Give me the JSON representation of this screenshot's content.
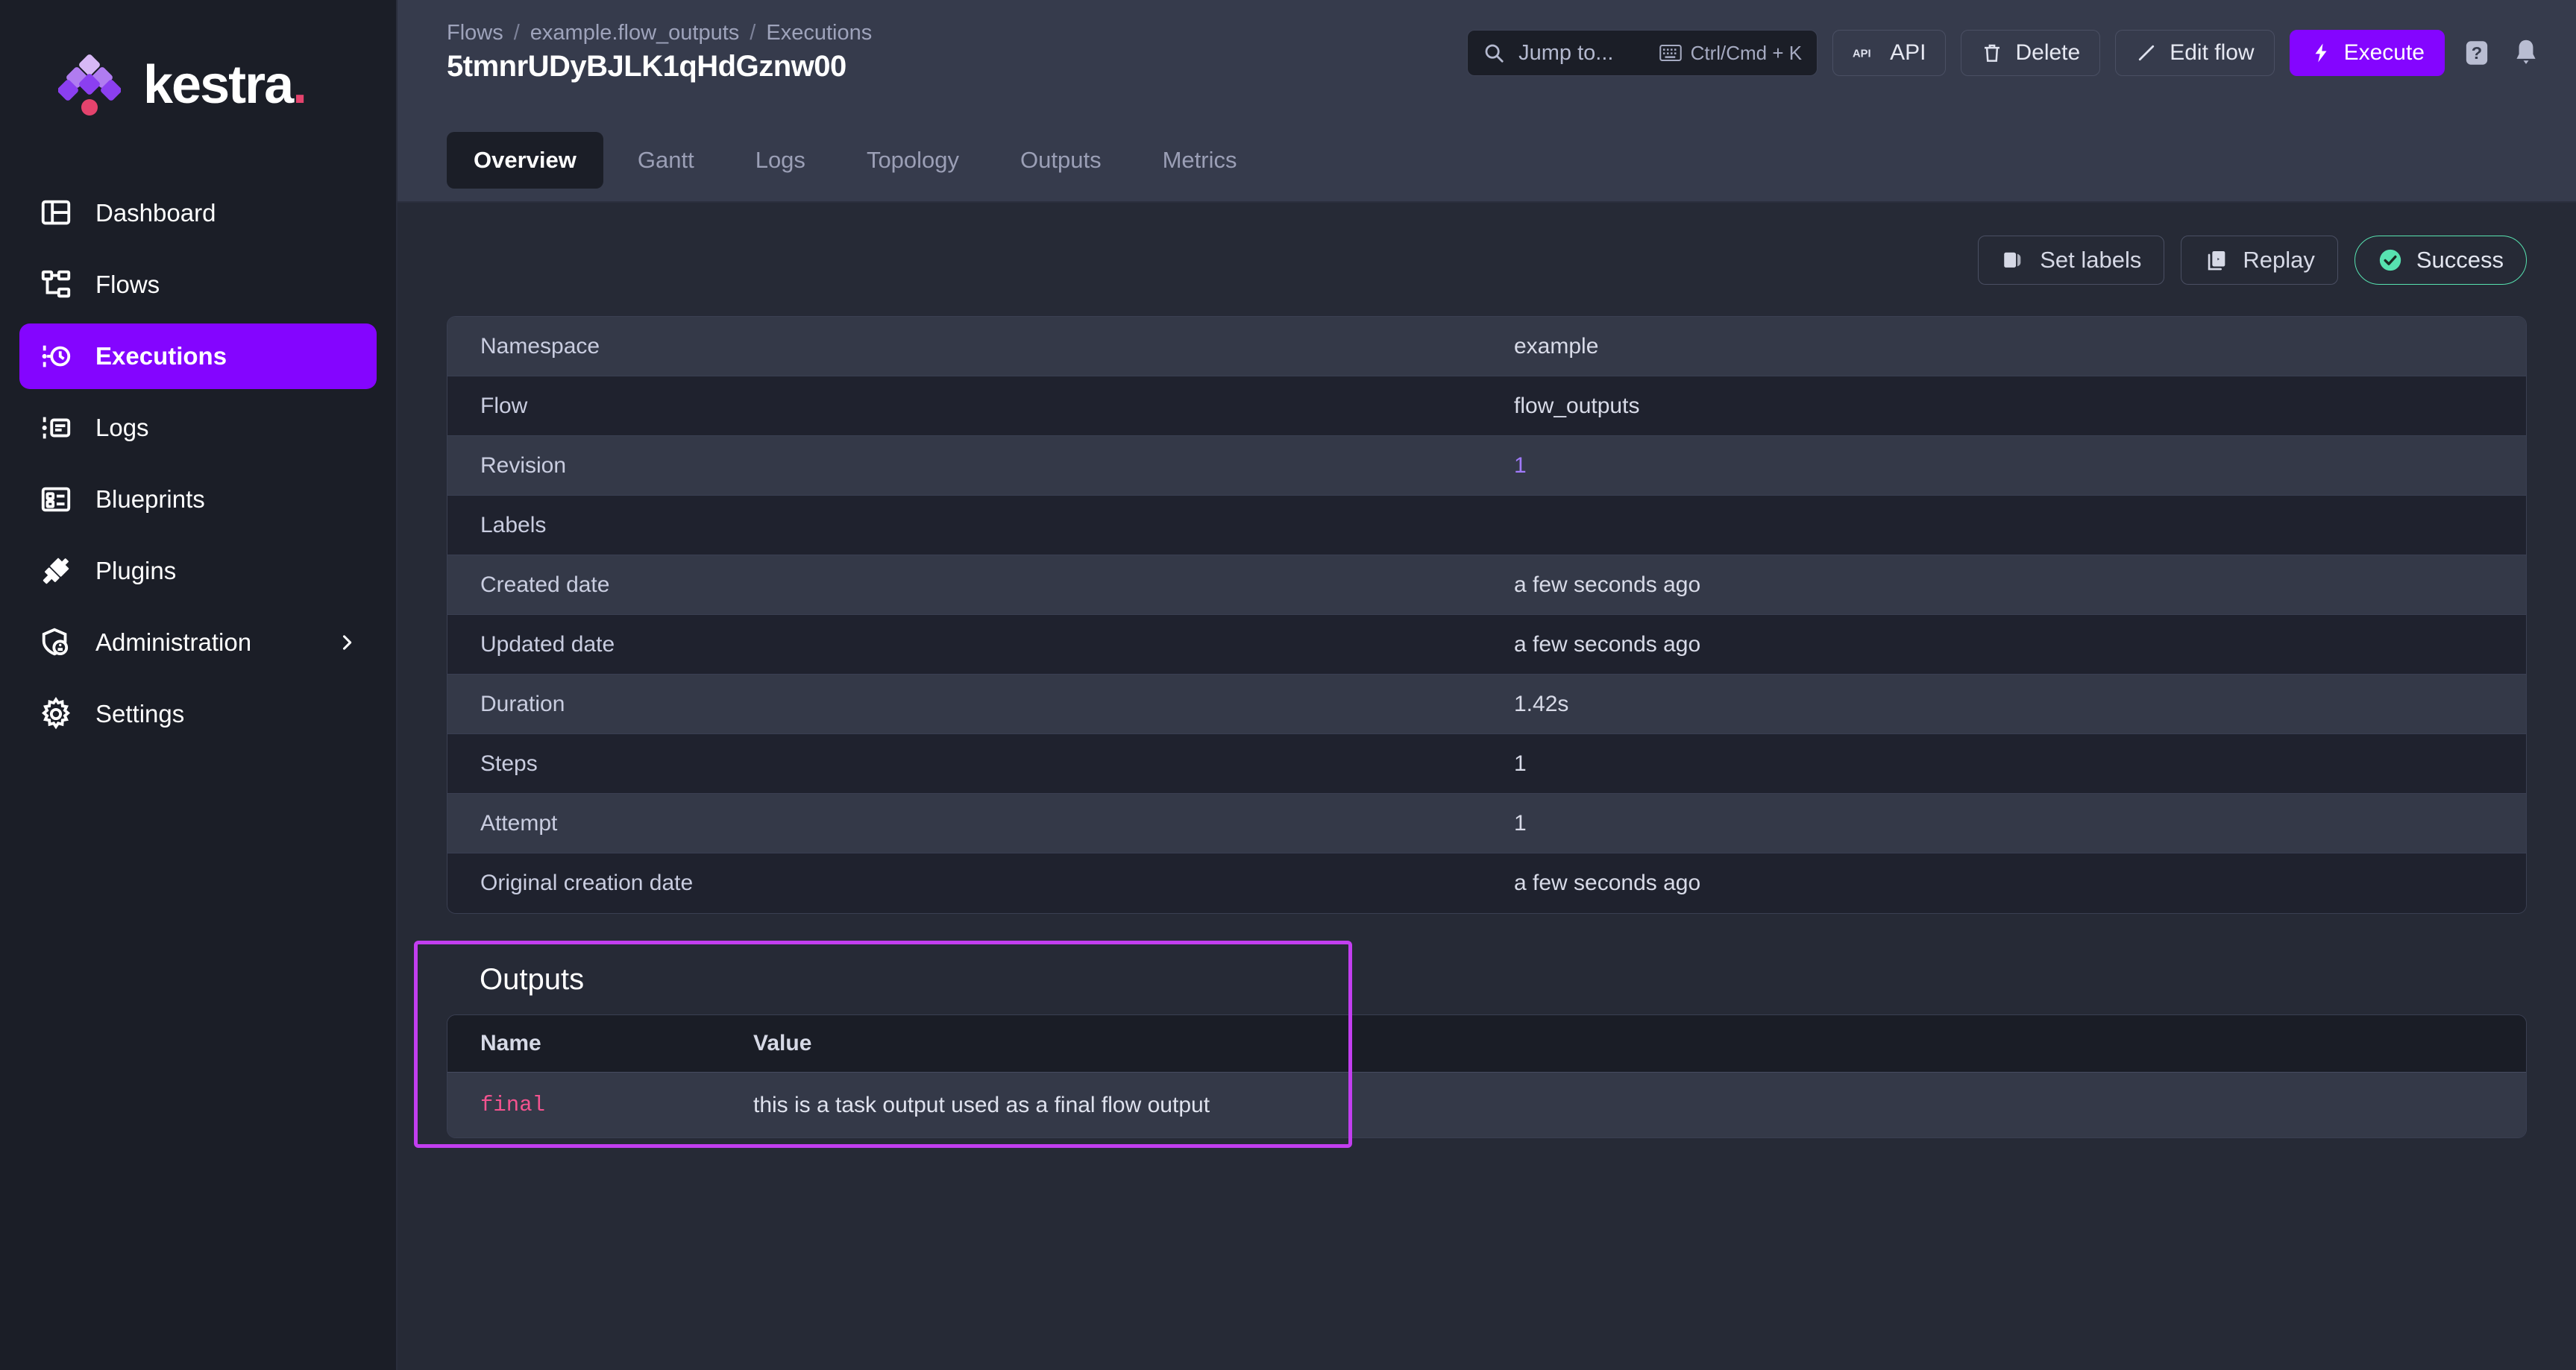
{
  "brand": {
    "name": "kestra",
    "dot": ".",
    "logo_colors": [
      "#d7b8f5",
      "#b07cf0",
      "#9b5cf0",
      "#8b3ff0",
      "#e4436d"
    ]
  },
  "sidebar": {
    "items": [
      {
        "label": "Dashboard",
        "icon": "dashboard-icon",
        "active": false
      },
      {
        "label": "Flows",
        "icon": "flows-icon",
        "active": false
      },
      {
        "label": "Executions",
        "icon": "executions-icon",
        "active": true
      },
      {
        "label": "Logs",
        "icon": "logs-icon",
        "active": false
      },
      {
        "label": "Blueprints",
        "icon": "blueprints-icon",
        "active": false
      },
      {
        "label": "Plugins",
        "icon": "plugins-icon",
        "active": false
      },
      {
        "label": "Administration",
        "icon": "administration-icon",
        "active": false,
        "chevron": true
      },
      {
        "label": "Settings",
        "icon": "settings-icon",
        "active": false
      }
    ],
    "active_color": "#8405ff"
  },
  "header": {
    "breadcrumb": [
      "Flows",
      "example.flow_outputs",
      "Executions"
    ],
    "separator": "/",
    "title": "5tmnrUDyBJLK1qHdGznw00",
    "search": {
      "placeholder": "Jump to...",
      "shortcut": "Ctrl/Cmd + K"
    },
    "buttons": [
      {
        "label": "API",
        "icon": "api-icon"
      },
      {
        "label": "Delete",
        "icon": "trash-icon"
      },
      {
        "label": "Edit flow",
        "icon": "pencil-icon"
      },
      {
        "label": "Execute",
        "icon": "bolt-icon",
        "primary": true
      }
    ],
    "icons": [
      {
        "name": "help-icon",
        "glyph": "?"
      },
      {
        "name": "bell-icon",
        "glyph": "bell"
      }
    ]
  },
  "tabs": [
    {
      "label": "Overview",
      "active": true
    },
    {
      "label": "Gantt",
      "active": false
    },
    {
      "label": "Logs",
      "active": false
    },
    {
      "label": "Topology",
      "active": false
    },
    {
      "label": "Outputs",
      "active": false
    },
    {
      "label": "Metrics",
      "active": false
    }
  ],
  "actions": [
    {
      "label": "Set labels",
      "icon": "label-icon"
    },
    {
      "label": "Replay",
      "icon": "replay-icon"
    }
  ],
  "status": {
    "label": "Success",
    "icon": "check-circle-icon",
    "color": "#57e2b0"
  },
  "details": [
    {
      "key": "Namespace",
      "value": "example",
      "link": false
    },
    {
      "key": "Flow",
      "value": "flow_outputs",
      "link": false
    },
    {
      "key": "Revision",
      "value": "1",
      "link": true
    },
    {
      "key": "Labels",
      "value": "",
      "link": false
    },
    {
      "key": "Created date",
      "value": "a few seconds ago",
      "link": false
    },
    {
      "key": "Updated date",
      "value": "a few seconds ago",
      "link": false
    },
    {
      "key": "Duration",
      "value": "1.42s",
      "link": false
    },
    {
      "key": "Steps",
      "value": "1",
      "link": false
    },
    {
      "key": "Attempt",
      "value": "1",
      "link": false
    },
    {
      "key": "Original creation date",
      "value": "a few seconds ago",
      "link": false
    }
  ],
  "outputs": {
    "title": "Outputs",
    "columns": [
      "Name",
      "Value"
    ],
    "rows": [
      {
        "name": "final",
        "value": "this is a task output used as a final flow output"
      }
    ],
    "highlight_color": "#c23ef0"
  }
}
